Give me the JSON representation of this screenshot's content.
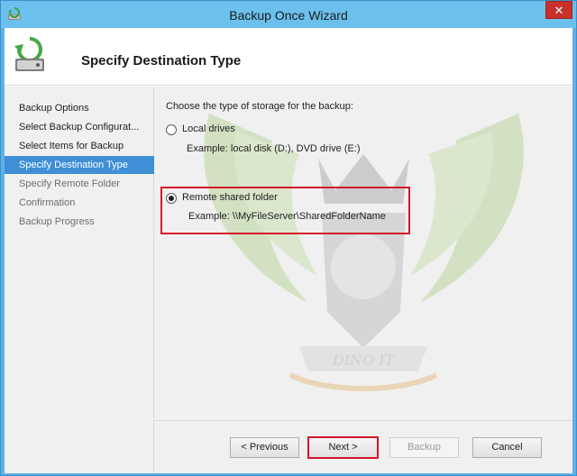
{
  "window": {
    "title": "Backup Once Wizard",
    "close_glyph": "✕"
  },
  "header": {
    "title": "Specify Destination Type",
    "icon": "backup-drive-icon"
  },
  "nav": {
    "items": [
      {
        "label": "Backup Options",
        "state": "normal"
      },
      {
        "label": "Select Backup Configurat...",
        "state": "normal"
      },
      {
        "label": "Select Items for Backup",
        "state": "normal"
      },
      {
        "label": "Specify Destination Type",
        "state": "selected"
      },
      {
        "label": "Specify Remote Folder",
        "state": "disabled"
      },
      {
        "label": "Confirmation",
        "state": "disabled"
      },
      {
        "label": "Backup Progress",
        "state": "disabled"
      }
    ]
  },
  "content": {
    "prompt": "Choose the type of storage for the backup:",
    "options": [
      {
        "label": "Local drives",
        "example": "Example: local disk (D:), DVD drive (E:)",
        "checked": false
      },
      {
        "label": "Remote shared folder",
        "example": "Example: \\\\MyFileServer\\SharedFolderName",
        "checked": true
      }
    ],
    "watermark_text": "DINO IT"
  },
  "footer": {
    "previous_label": "< Previous",
    "next_label": "Next >",
    "backup_label": "Backup",
    "cancel_label": "Cancel"
  },
  "colors": {
    "selection": "#3f8fd6",
    "highlight": "#d4182a",
    "titlebar": "#6cc0ee"
  }
}
